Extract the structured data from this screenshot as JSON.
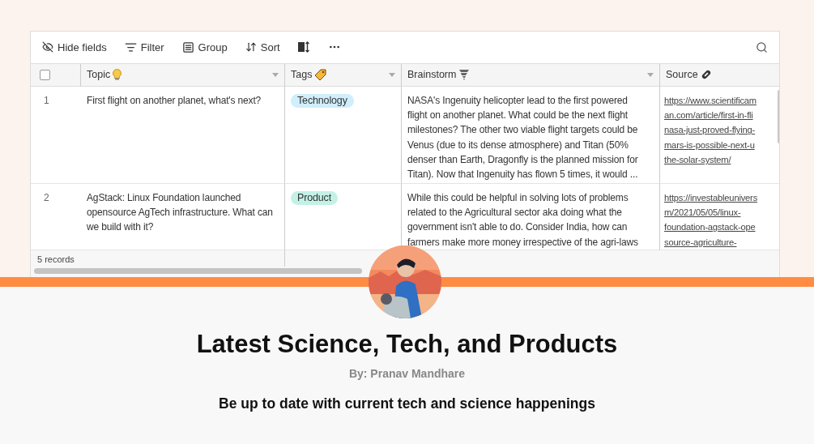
{
  "toolbar": [
    {
      "kind": "hide",
      "label": "Hide fields"
    },
    {
      "kind": "filter",
      "label": "Filter"
    },
    {
      "kind": "group",
      "label": "Group"
    },
    {
      "kind": "sort",
      "label": "Sort"
    },
    {
      "kind": "rowheight"
    },
    {
      "kind": "more"
    }
  ],
  "table": {
    "select_all": {
      "checked": false
    },
    "columns": [
      {
        "kind": "topic",
        "label": "Topic"
      },
      {
        "kind": "tags",
        "label": "Tags"
      },
      {
        "kind": "brainstorm",
        "label": "Brainstorm"
      },
      {
        "kind": "source",
        "label": "Source"
      }
    ],
    "rows": [
      {
        "number": "1",
        "topic": "First flight on another planet, what's next?",
        "tag": {
          "label": "Technology",
          "color": "#d0eefb"
        },
        "brainstorm": "NASA's Ingenuity helicopter lead to the first powered\nflight on another planet. What could be the next flight\nmilestones? The other two viable flight targets could be\nVenus (due to its dense atmosphere) and Titan (50%\ndenser than Earth, Dragonfly is the planned mission for\nTitan). Now that Ingenuity has flown 5 times, it would ...",
        "source": "https://www.scientificam\nan.com/article/first-in-fli\nnasa-just-proved-flying-\nmars-is-possible-next-u\nthe-solar-system/"
      },
      {
        "number": "2",
        "topic": "AgStack: Linux Foundation launched opensource AgTech infrastructure. What can we build with it?",
        "tag": {
          "label": "Product",
          "color": "#c3f1e6"
        },
        "brainstorm": "While this could be helpful in solving lots of problems\nrelated to the Agricultural sector aka doing what the\ngovernment isn't able to do. Consider India, how can\nfarmers make more money irrespective of the agri-laws",
        "source": "https://investableunivers\nm/2021/05/05/linux-\nfoundation-agstack-ope\nsource-agriculture-"
      }
    ],
    "footer": "5 records"
  },
  "profile": {
    "title": "Latest Science, Tech, and Products",
    "author": "By: Pranav Mandhare",
    "tagline": "Be up to date with current tech and science happenings"
  }
}
